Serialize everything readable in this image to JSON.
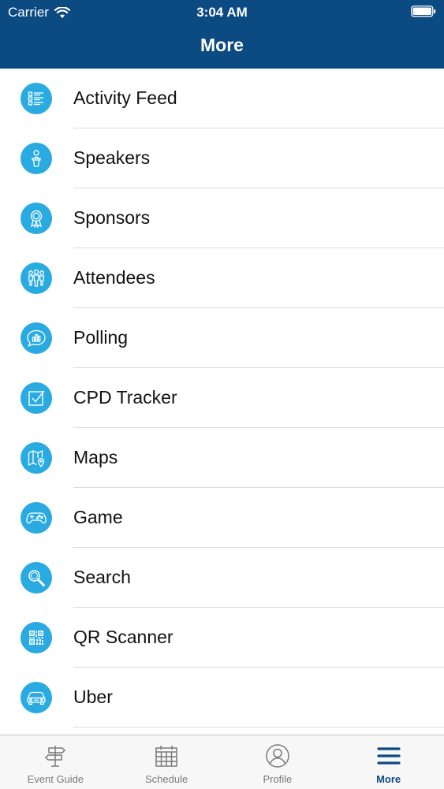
{
  "status_bar": {
    "carrier": "Carrier",
    "time": "3:04 AM"
  },
  "nav": {
    "title": "More"
  },
  "menu": {
    "icon_color": "#29abe2",
    "items": [
      {
        "label": "Activity Feed",
        "icon": "list-icon"
      },
      {
        "label": "Speakers",
        "icon": "speaker-icon"
      },
      {
        "label": "Sponsors",
        "icon": "ribbon-award-icon"
      },
      {
        "label": "Attendees",
        "icon": "people-icon"
      },
      {
        "label": "Polling",
        "icon": "chat-chart-icon"
      },
      {
        "label": "CPD Tracker",
        "icon": "checkbox-icon"
      },
      {
        "label": "Maps",
        "icon": "map-icon"
      },
      {
        "label": "Game",
        "icon": "gamepad-icon"
      },
      {
        "label": "Search",
        "icon": "search-icon"
      },
      {
        "label": "QR Scanner",
        "icon": "qr-code-icon"
      },
      {
        "label": "Uber",
        "icon": "car-icon"
      }
    ]
  },
  "tab_bar": {
    "active_color": "#0c4a82",
    "tabs": [
      {
        "label": "Event Guide",
        "icon": "signpost-icon",
        "active": false
      },
      {
        "label": "Schedule",
        "icon": "calendar-icon",
        "active": false
      },
      {
        "label": "Profile",
        "icon": "user-icon",
        "active": false
      },
      {
        "label": "More",
        "icon": "menu-icon",
        "active": true
      }
    ]
  },
  "theme": {
    "header_color": "#0c4a82"
  }
}
